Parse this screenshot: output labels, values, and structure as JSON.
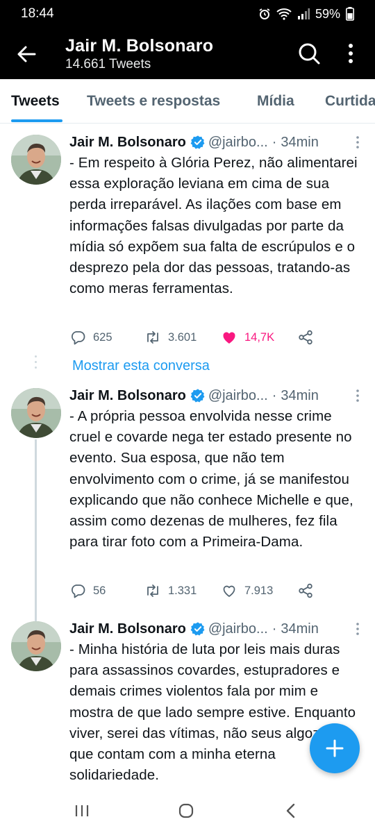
{
  "status_bar": {
    "time": "18:44",
    "battery": "59%"
  },
  "header": {
    "title": "Jair M. Bolsonaro",
    "subtitle": "14.661 Tweets"
  },
  "tabs": [
    {
      "label": "Tweets"
    },
    {
      "label": "Tweets e respostas"
    },
    {
      "label": "Mídia"
    },
    {
      "label": "Curtidas"
    }
  ],
  "tweets": [
    {
      "name": "Jair M. Bolsonaro",
      "handle": "@jairbo...",
      "time": "34min",
      "text": "- Em respeito à Glória Perez, não alimentarei essa exploração leviana em cima de sua perda irreparável. As ilações com base em informações falsas divulgadas por parte da mídia só expõem sua falta de escrúpulos e o desprezo pela dor das pessoas, tratando-as como meras ferramentas.",
      "replies": "625",
      "retweets": "3.601",
      "likes": "14,7K",
      "liked": true
    },
    {
      "name": "Jair M. Bolsonaro",
      "handle": "@jairbo...",
      "time": "34min",
      "text": "- A própria pessoa envolvida nesse crime cruel e covarde nega ter estado presente no evento. Sua esposa, que não tem envolvimento com o crime, já se manifestou explicando que não conhece Michelle e que, assim como dezenas de mulheres, fez fila para tirar foto com a Primeira-Dama.",
      "replies": "56",
      "retweets": "1.331",
      "likes": "7.913",
      "liked": false
    },
    {
      "name": "Jair M. Bolsonaro",
      "handle": "@jairbo...",
      "time": "34min",
      "text": "- Minha história de luta por leis mais duras para assassinos covardes, estupradores e demais crimes violentos fala por mim e mostra de que lado sempre estive. Enquanto viver, serei das vítimas, não seus algozes, que contam com a minha eterna solidariedade."
    }
  ],
  "show_thread_label": "Mostrar esta conversa",
  "colors": {
    "accent": "#1d9bf0",
    "like": "#f91880",
    "text": "#0f1419",
    "muted": "#536471"
  },
  "icons": [
    "back-arrow-icon",
    "search-icon",
    "more-vertical-icon",
    "verified-badge-icon",
    "reply-icon",
    "retweet-icon",
    "like-icon",
    "share-icon",
    "compose-plus-icon"
  ]
}
